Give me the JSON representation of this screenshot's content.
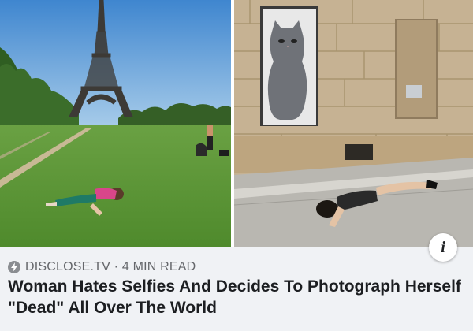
{
  "article": {
    "source": "DISCLOSE.TV",
    "separator": "·",
    "read_time": "4 MIN READ",
    "headline": "Woman Hates Selfies And Decides To Photograph Herself \"Dead\" All Over The World"
  },
  "info_button": {
    "label": "i",
    "icon": "info-icon"
  },
  "source_icon": "lightning-bolt-icon",
  "colors": {
    "background": "#f0f2f5",
    "meta_text": "#65676b",
    "headline_text": "#1c1e21",
    "sky": "#5f9fd8",
    "grass": "#5f9a3a"
  }
}
